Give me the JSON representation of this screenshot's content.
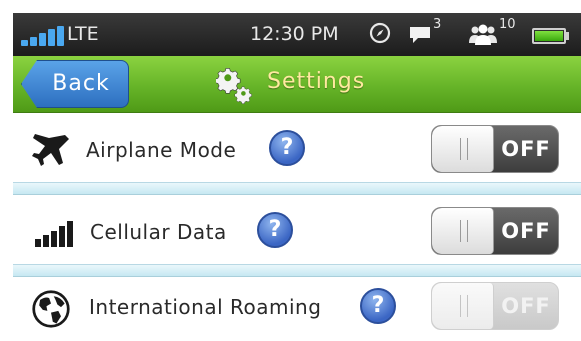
{
  "status_bar": {
    "network": "LTE",
    "time": "12:30 PM",
    "messages_count": "3",
    "contacts_count": "10",
    "signal_color": "#4aa8f0",
    "battery_color": "#3aa80e"
  },
  "nav": {
    "back_label": "Back",
    "title": "Settings",
    "title_color": "#ffe9a0",
    "bar_color": "#66b428"
  },
  "settings": [
    {
      "label": "Airplane Mode",
      "icon": "airplane-icon",
      "help": "?",
      "toggle": "OFF",
      "enabled": true
    },
    {
      "label": "Cellular Data",
      "icon": "signal-bars-icon",
      "help": "?",
      "toggle": "OFF",
      "enabled": true
    },
    {
      "label": "International Roaming",
      "icon": "globe-icon",
      "help": "?",
      "toggle": "OFF",
      "enabled": false
    }
  ]
}
